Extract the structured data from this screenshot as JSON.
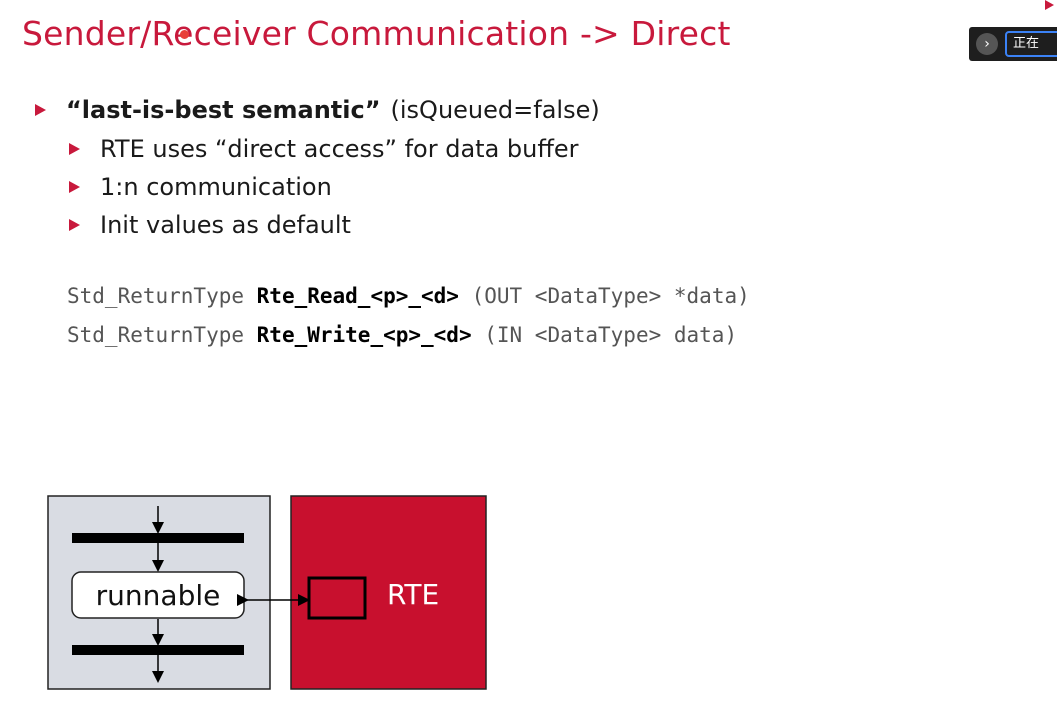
{
  "slide": {
    "title": "Sender/Receiver Communication -> Direct",
    "bullets": {
      "main_bold": "“last-is-best semantic”",
      "main_rest": "(isQueued=false)",
      "sub": [
        "RTE uses “direct access” for data buffer",
        "1:n communication",
        "Init values as default"
      ]
    },
    "code": [
      {
        "prefix": "Std_ReturnType ",
        "func": "Rte_Read_<p>_<d>",
        "suffix": " (OUT <DataType> *data)"
      },
      {
        "prefix": "Std_ReturnType ",
        "func": "Rte_Write_<p>_<d>",
        "suffix": " (IN <DataType> data)"
      }
    ],
    "diagram": {
      "runnable_label": "runnable",
      "rte_label": "RTE"
    }
  },
  "overlay": {
    "label": "正在",
    "icon": "chevron-right-icon"
  },
  "colors": {
    "accent": "#c8193c",
    "rte_box": "#c8102e",
    "component_box": "#d9dce3"
  }
}
